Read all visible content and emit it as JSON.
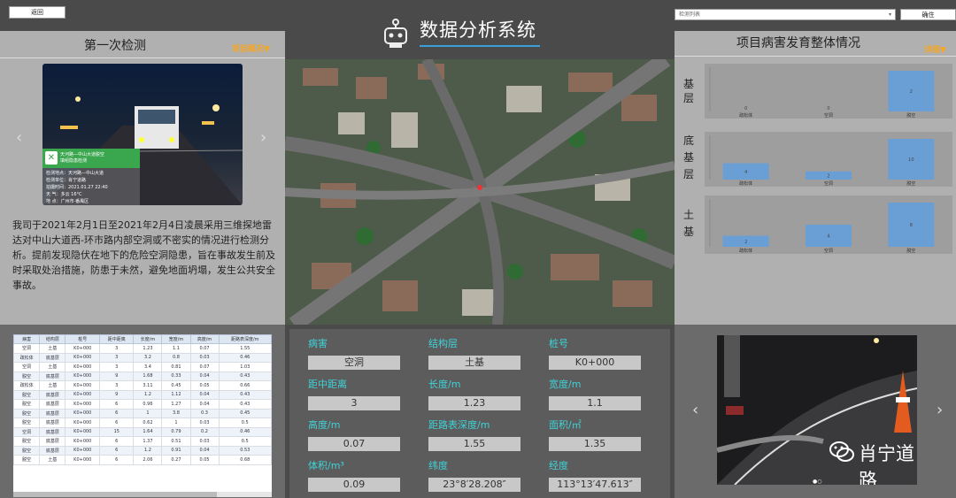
{
  "header": {
    "back_label": "返回",
    "title": "数据分析系统",
    "select_value": "检测列表",
    "confirm_label": "确住"
  },
  "left": {
    "title": "第一次检测",
    "tag": "项目概况",
    "photo_caption": {
      "title": "天河路—中山大道脱空\n填组隐患检测",
      "lines": [
        "检测地点：天河路—中山大道",
        "检测单位：肖宁道路",
        "拍摄时间：2021.01.27 22:40",
        "天      气：多云 16°C",
        "地      点：广州市·番禺区"
      ]
    },
    "description": "我司于2021年2月1日至2021年2月4日凌晨采用三维探地雷达对中山大道西-环市路内部空洞或不密实的情况进行检测分析。提前发现隐伏在地下的危险空洞隐患，旨在事故发生前及时采取处治措施，防患于未然，避免地面坍塌，发生公共安全事故。"
  },
  "right_top": {
    "title": "项目病害发育整体情况",
    "tag": "详细"
  },
  "chart_data": [
    {
      "type": "bar",
      "row_label": "基层",
      "categories": [
        "疏松体",
        "空洞",
        "脱空"
      ],
      "values": [
        0,
        0,
        2
      ]
    },
    {
      "type": "bar",
      "row_label": "底基层",
      "categories": [
        "疏松体",
        "空洞",
        "脱空"
      ],
      "values": [
        4,
        2,
        10
      ]
    },
    {
      "type": "bar",
      "row_label": "土基",
      "categories": [
        "疏松体",
        "空洞",
        "脱空"
      ],
      "values": [
        2,
        4,
        8
      ]
    }
  ],
  "table": {
    "headers": [
      "病害",
      "结构层",
      "桩号",
      "距中距离",
      "长度/m",
      "宽度/m",
      "高度/m",
      "距路表深度/m"
    ],
    "rows": [
      [
        "空洞",
        "土基",
        "K0+000",
        "3",
        "1.23",
        "1.1",
        "0.07",
        "1.55"
      ],
      [
        "疏松体",
        "底基层",
        "K0+000",
        "3",
        "3.2",
        "0.8",
        "0.03",
        "0.46"
      ],
      [
        "空洞",
        "土基",
        "K0+000",
        "3",
        "3.4",
        "0.81",
        "0.07",
        "1.03"
      ],
      [
        "脱空",
        "底基层",
        "K0+000",
        "9",
        "1.68",
        "0.33",
        "0.04",
        "0.43"
      ],
      [
        "疏松体",
        "土基",
        "K0+000",
        "3",
        "3.11",
        "0.45",
        "0.05",
        "0.66"
      ],
      [
        "脱空",
        "底基层",
        "K0+000",
        "9",
        "1.2",
        "1.12",
        "0.04",
        "0.43"
      ],
      [
        "脱空",
        "底基层",
        "K0+000",
        "6",
        "0.96",
        "1.27",
        "0.04",
        "0.43"
      ],
      [
        "脱空",
        "底基层",
        "K0+000",
        "6",
        "1",
        "3.8",
        "0.3",
        "0.45"
      ],
      [
        "脱空",
        "底基层",
        "K0+000",
        "6",
        "0.62",
        "1",
        "0.03",
        "0.5"
      ],
      [
        "空洞",
        "底基层",
        "K0+000",
        "15",
        "1.64",
        "0.79",
        "0.2",
        "0.46"
      ],
      [
        "脱空",
        "底基层",
        "K0+000",
        "6",
        "1.37",
        "0.51",
        "0.03",
        "0.5"
      ],
      [
        "脱空",
        "底基层",
        "K0+000",
        "6",
        "1.2",
        "0.91",
        "0.04",
        "0.53"
      ],
      [
        "脱空",
        "土基",
        "K0+000",
        "6",
        "2.06",
        "0.27",
        "0.05",
        "0.68"
      ]
    ]
  },
  "detail": {
    "fields": [
      {
        "label": "病害",
        "value": "空洞"
      },
      {
        "label": "结构层",
        "value": "土基"
      },
      {
        "label": "桩号",
        "value": "K0+000"
      },
      {
        "label": "距中距离",
        "value": "3"
      },
      {
        "label": "长度/m",
        "value": "1.23"
      },
      {
        "label": "宽度/m",
        "value": "1.1"
      },
      {
        "label": "高度/m",
        "value": "0.07"
      },
      {
        "label": "距路表深度/m",
        "value": "1.55"
      },
      {
        "label": "面积/㎡",
        "value": "1.35"
      },
      {
        "label": "体积/m³",
        "value": "0.09"
      },
      {
        "label": "纬度",
        "value": "23°8′28.208″"
      },
      {
        "label": "经度",
        "value": "113°13′47.613″"
      }
    ]
  },
  "watermark": "肖宁道路"
}
